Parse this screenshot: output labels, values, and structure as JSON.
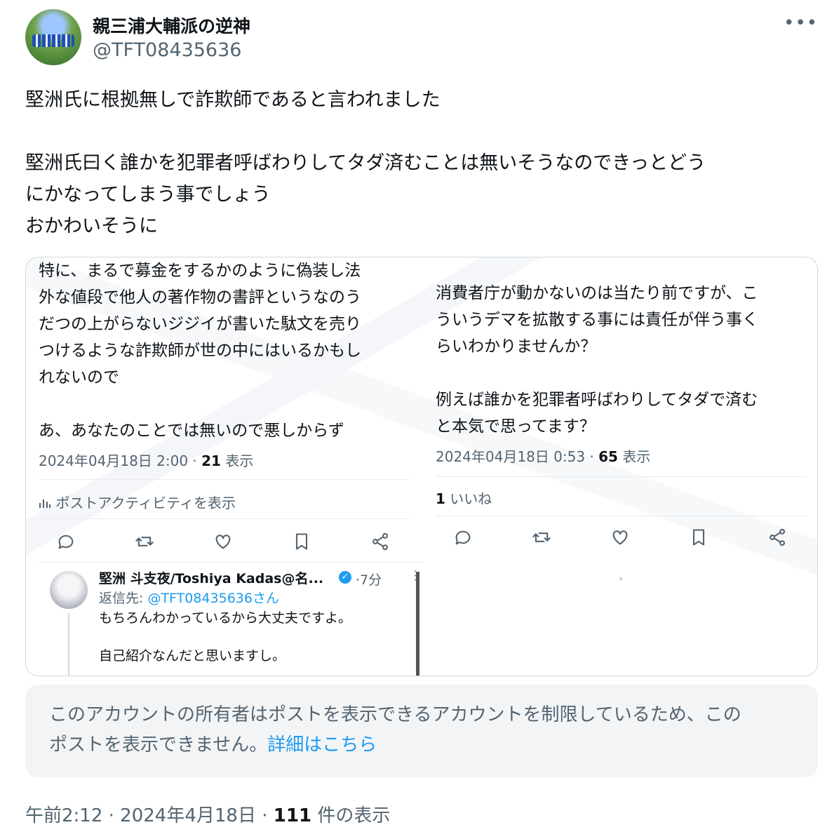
{
  "author": {
    "display_name": "親三浦大輔派の逆神",
    "handle": "@TFT08435636"
  },
  "tweet": {
    "text": "堅洲氏に根拠無しで詐欺師であると言われました\n\n堅洲氏曰く誰かを犯罪者呼ばわりしてタダ済むことは無いそうなのできっとどう\nにかなってしまう事でしょう\nおかわいそうに"
  },
  "image_left": {
    "text": "特に、まるで募金をするかのように偽装し法\n外な値段で他人の著作物の書評というなのう\nだつの上がらないジジイが書いた駄文を売り\nつけるような詐欺師が世の中にはいるかもし\nれないので\n\nあ、あなたのことでは無いので悪しからず",
    "timestamp": "2024年04月18日 2:00 · ",
    "views_count": "21",
    "views_label": " 表示",
    "activity_label": "ポストアクティビティを表示"
  },
  "image_right": {
    "text": "消費者庁が動かないのは当たり前ですが、こ\nういうデマを拡散する事には責任が伴う事く\nらいわかりませんか？\n\n例えば誰かを犯罪者呼ばわりしてタダで済む\nと本気で思ってます？",
    "timestamp": "2024年04月18日 0:53 · ",
    "views_count": "65",
    "views_label": " 表示",
    "likes_count": "1",
    "likes_label": " いいね"
  },
  "reply": {
    "name": "堅洲 斗支夜/Toshiya Kadas@名...",
    "time": "·7分",
    "reply_to_prefix": "返信先: ",
    "reply_to_handle": "@TFT08435636さん",
    "text": "もちろんわかっているから大丈夫ですよ。\n\n自己紹介なんだと思いますし。"
  },
  "notice": {
    "text": "このアカウントの所有者はポストを表示できるアカウントを制限しているため、この\nポストを表示できません。",
    "link": "詳細はこちら"
  },
  "footer": {
    "time": "午前2:12 · 2024年4月18日 · ",
    "views_count": "111",
    "views_label": " 件の表示"
  },
  "icons": [
    "more-icon",
    "reply-icon",
    "retweet-icon",
    "like-icon",
    "bookmark-icon",
    "share-icon",
    "analytics-icon",
    "verified-icon"
  ],
  "colors": {
    "link": "#1d9bf0",
    "secondary": "#536471",
    "text": "#0f1419"
  }
}
